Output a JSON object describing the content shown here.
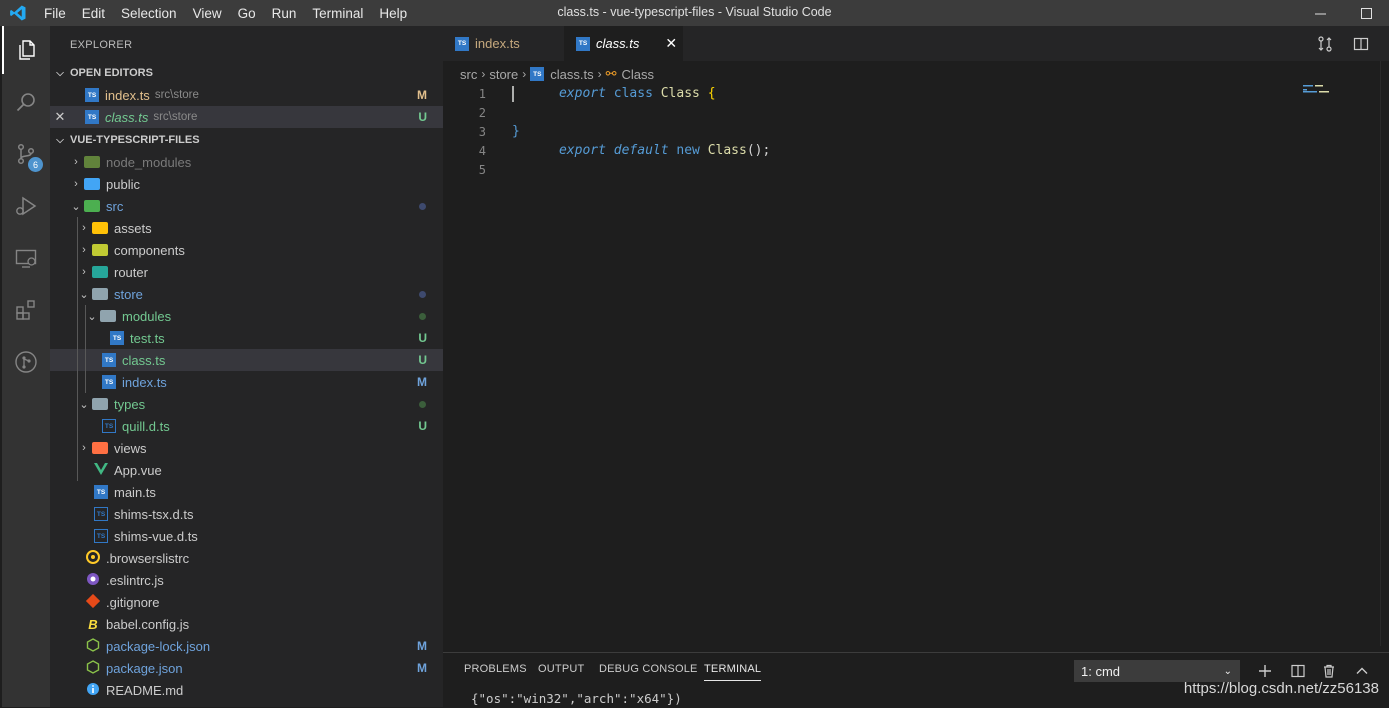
{
  "menu": [
    "File",
    "Edit",
    "Selection",
    "View",
    "Go",
    "Run",
    "Terminal",
    "Help"
  ],
  "window_title": "class.ts - vue-typescript-files - Visual Studio Code",
  "activity_badge": "6",
  "explorer": {
    "title": "EXPLORER",
    "open_editors_header": "OPEN EDITORS",
    "open_editors": [
      {
        "name": "index.ts",
        "path": "src\\store",
        "status": "M"
      },
      {
        "name": "class.ts",
        "path": "src\\store",
        "status": "U"
      }
    ],
    "project_header": "VUE-TYPESCRIPT-FILES",
    "tree": [
      {
        "name": "node_modules"
      },
      {
        "name": "public"
      },
      {
        "name": "src"
      },
      {
        "name": "assets"
      },
      {
        "name": "components"
      },
      {
        "name": "router"
      },
      {
        "name": "store"
      },
      {
        "name": "modules"
      },
      {
        "name": "test.ts",
        "status": "U"
      },
      {
        "name": "class.ts",
        "status": "U"
      },
      {
        "name": "index.ts",
        "status": "M"
      },
      {
        "name": "types"
      },
      {
        "name": "quill.d.ts",
        "status": "U"
      },
      {
        "name": "views"
      },
      {
        "name": "App.vue"
      },
      {
        "name": "main.ts"
      },
      {
        "name": "shims-tsx.d.ts"
      },
      {
        "name": "shims-vue.d.ts"
      },
      {
        "name": ".browserslistrc"
      },
      {
        "name": ".eslintrc.js"
      },
      {
        "name": ".gitignore"
      },
      {
        "name": "babel.config.js"
      },
      {
        "name": "package-lock.json",
        "status": "M"
      },
      {
        "name": "package.json",
        "status": "M"
      },
      {
        "name": "README.md"
      }
    ]
  },
  "tabs": [
    {
      "label": "index.ts"
    },
    {
      "label": "class.ts"
    }
  ],
  "breadcrumb": [
    "src",
    "store",
    "class.ts",
    "Class"
  ],
  "code": {
    "line_numbers": [
      "1",
      "2",
      "3",
      "4",
      "5"
    ],
    "line1": {
      "export": "export",
      "class": "class",
      "name": "Class",
      "brace": "{"
    },
    "line3": {
      "brace": "}"
    },
    "line4": {
      "export": "export",
      "default": "default",
      "new": "new",
      "name": "Class",
      "rest": "();"
    }
  },
  "panel": {
    "tabs": [
      "PROBLEMS",
      "OUTPUT",
      "DEBUG CONSOLE",
      "TERMINAL"
    ],
    "terminal_select": "1: cmd",
    "terminal_output": "{\"os\":\"win32\",\"arch\":\"x64\"})"
  },
  "watermark": "https://blog.csdn.net/zz56138",
  "colors": {
    "modified": "#e2c08d",
    "untracked": "#73c991",
    "accent": "#007acc"
  }
}
